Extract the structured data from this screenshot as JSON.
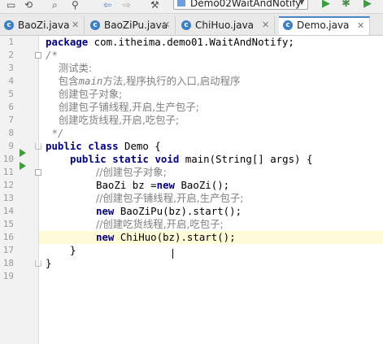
{
  "toolbar": {
    "run_config": "Demo02WaitAndNotify",
    "icons": [
      "search-icon",
      "replace-icon",
      "back-icon",
      "forward-icon",
      "run-icon",
      "debug-icon",
      "coverage-icon"
    ]
  },
  "tabs": [
    {
      "label": "BaoZi.java",
      "active": false
    },
    {
      "label": "BaoZiPu.java",
      "active": false
    },
    {
      "label": "ChiHuo.java",
      "active": false
    },
    {
      "label": "Demo.java",
      "active": true
    }
  ],
  "editor": {
    "line_numbers": [
      "1",
      "2",
      "3",
      "4",
      "5",
      "6",
      "7",
      "8",
      "9",
      "10",
      "11",
      "12",
      "13",
      "14",
      "15",
      "16",
      "17",
      "18",
      "19"
    ],
    "current_line": 16,
    "code": {
      "l1_kw": "package",
      "l1_rest": " com.itheima.demo01.WaitAndNotify;",
      "l2": "/*",
      "l3": "    测试类:",
      "l4_a": "    包含",
      "l4_b": "main",
      "l4_c": "方法,程序执行的入口,启动程序",
      "l5": "    创建包子对象;",
      "l6": "    创建包子铺线程,开启,生产包子;",
      "l7": "    创建吃货线程,开启,吃包子;",
      "l8": " */",
      "l9_kw1": "public",
      "l9_kw2": "class",
      "l9_rest": " Demo {",
      "l10_kw1": "public",
      "l10_kw2": "static",
      "l10_kw3": "void",
      "l10_rest": " main(String[] args) {",
      "l11": "//创建包子对象;",
      "l12_a": "BaoZi bz =",
      "l12_kw": "new",
      "l12_b": " BaoZi();",
      "l13": "//创建包子铺线程,开启,生产包子;",
      "l14_kw": "new",
      "l14_b": " BaoZiPu(bz).start();",
      "l15": "//创建吃货线程,开启,吃包子;",
      "l16_kw": "new",
      "l16_b": " ChiHuo(bz).start();",
      "l17": "}",
      "l18": "}"
    }
  },
  "colors": {
    "keyword": "#000080",
    "comment": "#808080",
    "current_line": "#fffbd8",
    "active_tab_accent": "#4a86c8"
  }
}
